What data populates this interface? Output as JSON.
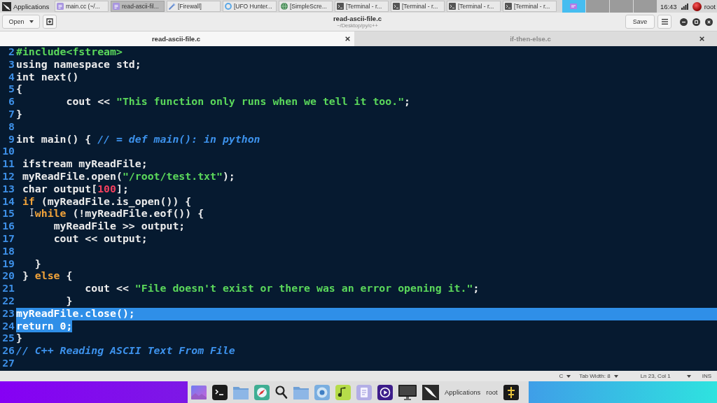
{
  "taskbar": {
    "menu": "Applications",
    "windows": [
      {
        "title": "main.cc (~/...",
        "selected": false
      },
      {
        "title": "read-ascii-fil...",
        "selected": true
      },
      {
        "title": "[Firewall]",
        "selected": false
      },
      {
        "title": "[UFO Hunter...",
        "selected": false
      },
      {
        "title": "[SimpleScre...",
        "selected": false
      },
      {
        "title": "[Terminal - r...",
        "selected": false
      },
      {
        "title": "[Terminal - r...",
        "selected": false
      },
      {
        "title": "[Terminal - r...",
        "selected": false
      },
      {
        "title": "[Terminal - r...",
        "selected": false
      }
    ],
    "workspaces": [
      {
        "selected": true
      },
      {
        "selected": false
      },
      {
        "selected": false
      },
      {
        "selected": false
      }
    ],
    "clock": "16:43",
    "user": "root"
  },
  "toolbar": {
    "open_button": "Open",
    "title": "read-ascii-file.c",
    "subtitle": "~/Desktop/py/c++",
    "save_button": "Save"
  },
  "tabs": [
    {
      "label": "read-ascii-file.c",
      "selected": true
    },
    {
      "label": "if-then-else.c",
      "selected": false
    }
  ],
  "editor": {
    "lines": [
      {
        "number": "2",
        "selected": false,
        "tokens": [
          {
            "kind": "preproc",
            "text": "#include<fstream>"
          }
        ]
      },
      {
        "number": "3",
        "selected": false,
        "tokens": [
          {
            "kind": "plain",
            "text": "using namespace std;"
          }
        ]
      },
      {
        "number": "4",
        "selected": false,
        "tokens": [
          {
            "kind": "plain",
            "text": "int next()"
          }
        ]
      },
      {
        "number": "5",
        "selected": false,
        "tokens": [
          {
            "kind": "plain",
            "text": "{"
          }
        ]
      },
      {
        "number": "6",
        "selected": false,
        "tokens": [
          {
            "kind": "plain",
            "text": "        cout << "
          },
          {
            "kind": "string",
            "text": "\"This function only runs when we tell it too.\""
          },
          {
            "kind": "plain",
            "text": ";"
          }
        ]
      },
      {
        "number": "7",
        "selected": false,
        "tokens": [
          {
            "kind": "plain",
            "text": "}"
          }
        ]
      },
      {
        "number": "8",
        "selected": false
      },
      {
        "number": "9",
        "selected": false,
        "tokens": [
          {
            "kind": "plain",
            "text": "int main() { "
          },
          {
            "kind": "comment",
            "text": "// = def main(): in python"
          }
        ]
      },
      {
        "number": "10",
        "selected": false
      },
      {
        "number": "11",
        "selected": false,
        "tokens": [
          {
            "kind": "plain",
            "text": " ifstream myReadFile;"
          }
        ]
      },
      {
        "number": "12",
        "selected": false,
        "tokens": [
          {
            "kind": "plain",
            "text": " myReadFile.open("
          },
          {
            "kind": "string",
            "text": "\"/root/test.txt\""
          },
          {
            "kind": "plain",
            "text": ");"
          }
        ]
      },
      {
        "number": "13",
        "selected": false,
        "tokens": [
          {
            "kind": "plain",
            "text": " char output["
          },
          {
            "kind": "number",
            "text": "100"
          },
          {
            "kind": "plain",
            "text": "];"
          }
        ]
      },
      {
        "number": "14",
        "selected": false,
        "tokens": [
          {
            "kind": "keyword",
            "text": " if"
          },
          {
            "kind": "plain",
            "text": " (myReadFile.is_open()) {"
          }
        ]
      },
      {
        "number": "15",
        "selected": false,
        "tokens": [
          {
            "kind": "keyword",
            "text": "   while"
          },
          {
            "kind": "plain",
            "text": " (!myReadFile.eof()) {"
          }
        ]
      },
      {
        "number": "16",
        "selected": false,
        "tokens": [
          {
            "kind": "plain",
            "text": "      myReadFile >> output;"
          }
        ]
      },
      {
        "number": "17",
        "selected": false,
        "tokens": [
          {
            "kind": "plain",
            "text": "      cout << output;"
          }
        ]
      },
      {
        "number": "18",
        "selected": false
      },
      {
        "number": "19",
        "selected": false,
        "tokens": [
          {
            "kind": "plain",
            "text": "   }"
          }
        ]
      },
      {
        "number": "20",
        "selected": false,
        "tokens": [
          {
            "kind": "plain",
            "text": " } "
          },
          {
            "kind": "keyword",
            "text": "else"
          },
          {
            "kind": "plain",
            "text": " {"
          }
        ]
      },
      {
        "number": "21",
        "selected": false,
        "tokens": [
          {
            "kind": "plain",
            "text": "           cout << "
          },
          {
            "kind": "string",
            "text": "\"File doesn't exist or there was an error opening it.\""
          },
          {
            "kind": "plain",
            "text": ";"
          }
        ]
      },
      {
        "number": "22",
        "selected": false,
        "tokens": [
          {
            "kind": "plain",
            "text": "        }"
          }
        ]
      },
      {
        "number": "23",
        "selected": true,
        "tokens": [
          {
            "kind": "plain",
            "text": "myReadFile.close();"
          }
        ]
      },
      {
        "number": "24",
        "selected": true,
        "tokens": [
          {
            "kind": "plain",
            "text": "return 0;"
          }
        ]
      },
      {
        "number": "25",
        "selected": false,
        "tokens": [
          {
            "kind": "plain",
            "text": "}"
          }
        ]
      },
      {
        "number": "26",
        "selected": false,
        "tokens": [
          {
            "kind": "comment",
            "text": "// C++ Reading ASCII Text From File"
          }
        ]
      },
      {
        "number": "27",
        "selected": false
      }
    ]
  },
  "status_bar": {
    "language": "C",
    "tab_width": "Tab Width: 8",
    "cursor_position": "Ln 23, Col 1",
    "input_mode": "INS"
  },
  "dock": {
    "menu": "Applications",
    "user": "root"
  }
}
